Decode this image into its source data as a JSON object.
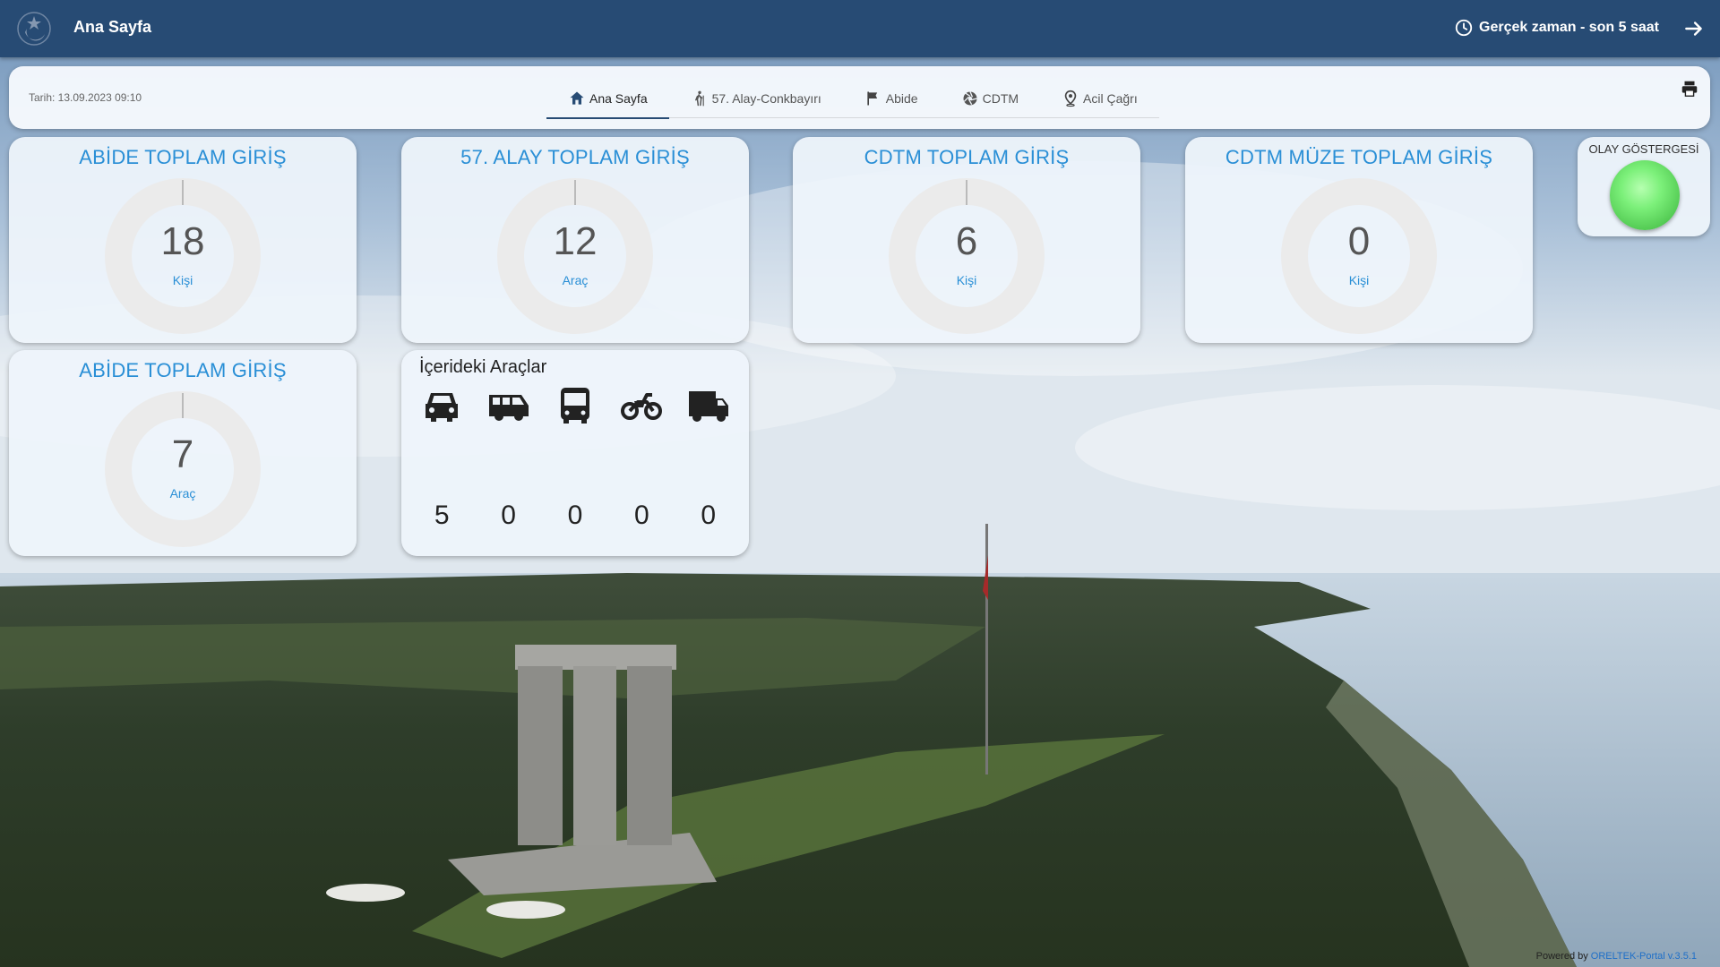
{
  "header": {
    "title": "Ana Sayfa",
    "time_range": "Gerçek zaman - son 5 saat"
  },
  "nav": {
    "date": "Tarih: 13.09.2023 09:10",
    "tabs": [
      {
        "label": "Ana Sayfa",
        "icon": "home-icon",
        "active": true
      },
      {
        "label": "57. Alay-Conkbayırı",
        "icon": "hiker-icon",
        "active": false
      },
      {
        "label": "Abide",
        "icon": "flag-icon",
        "active": false
      },
      {
        "label": "CDTM",
        "icon": "aperture-icon",
        "active": false
      },
      {
        "label": "Acil Çağrı",
        "icon": "location-pin-icon",
        "active": false
      }
    ]
  },
  "metrics": [
    {
      "title": "ABİDE TOPLAM GİRİŞ",
      "value": "18",
      "unit": "Kişi"
    },
    {
      "title": "57. ALAY TOPLAM GİRİŞ",
      "value": "12",
      "unit": "Araç"
    },
    {
      "title": "CDTM TOPLAM GİRİŞ",
      "value": "6",
      "unit": "Kişi"
    },
    {
      "title": "CDTM MÜZE TOPLAM GİRİŞ",
      "value": "0",
      "unit": "Kişi"
    },
    {
      "title": "ABİDE TOPLAM GİRİŞ",
      "value": "7",
      "unit": "Araç"
    }
  ],
  "vehicles": {
    "title": "İçerideki Araçlar",
    "items": [
      {
        "icon": "car-icon",
        "count": "5"
      },
      {
        "icon": "van-icon",
        "count": "0"
      },
      {
        "icon": "bus-icon",
        "count": "0"
      },
      {
        "icon": "motorcycle-icon",
        "count": "0"
      },
      {
        "icon": "truck-icon",
        "count": "0"
      }
    ]
  },
  "indicator": {
    "title": "OLAY GÖSTERGESİ",
    "status_color": "#6be86a"
  },
  "footer": {
    "prefix": "Powered by",
    "link": "ORELTEK-Portal v.3.5.1"
  },
  "colors": {
    "topbar": "#274b74",
    "accent": "#2a8fd6"
  }
}
